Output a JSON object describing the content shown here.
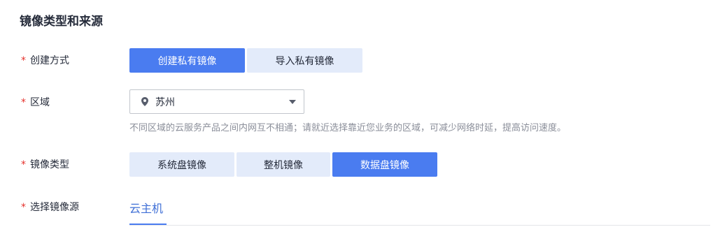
{
  "section": {
    "title": "镜像类型和来源"
  },
  "required_mark": "*",
  "create_method": {
    "label": "创建方式",
    "options": [
      "创建私有镜像",
      "导入私有镜像"
    ],
    "selected": "创建私有镜像"
  },
  "region": {
    "label": "区域",
    "value": "苏州",
    "icon": "location-pin-icon",
    "hint": "不同区域的云服务产品之间内网互不相通；请就近选择靠近您业务的区域，可减少网络时延，提高访问速度。"
  },
  "image_type": {
    "label": "镜像类型",
    "options": [
      "系统盘镜像",
      "整机镜像",
      "数据盘镜像"
    ],
    "selected": "数据盘镜像"
  },
  "image_source": {
    "label": "选择镜像源",
    "tabs": [
      "云主机"
    ],
    "selected_tab": "云主机"
  },
  "colors": {
    "accent": "#4a7cf0",
    "inactive_segment": "#e3ebfa",
    "required": "#e5322d",
    "hint_text": "#8a8e99"
  }
}
